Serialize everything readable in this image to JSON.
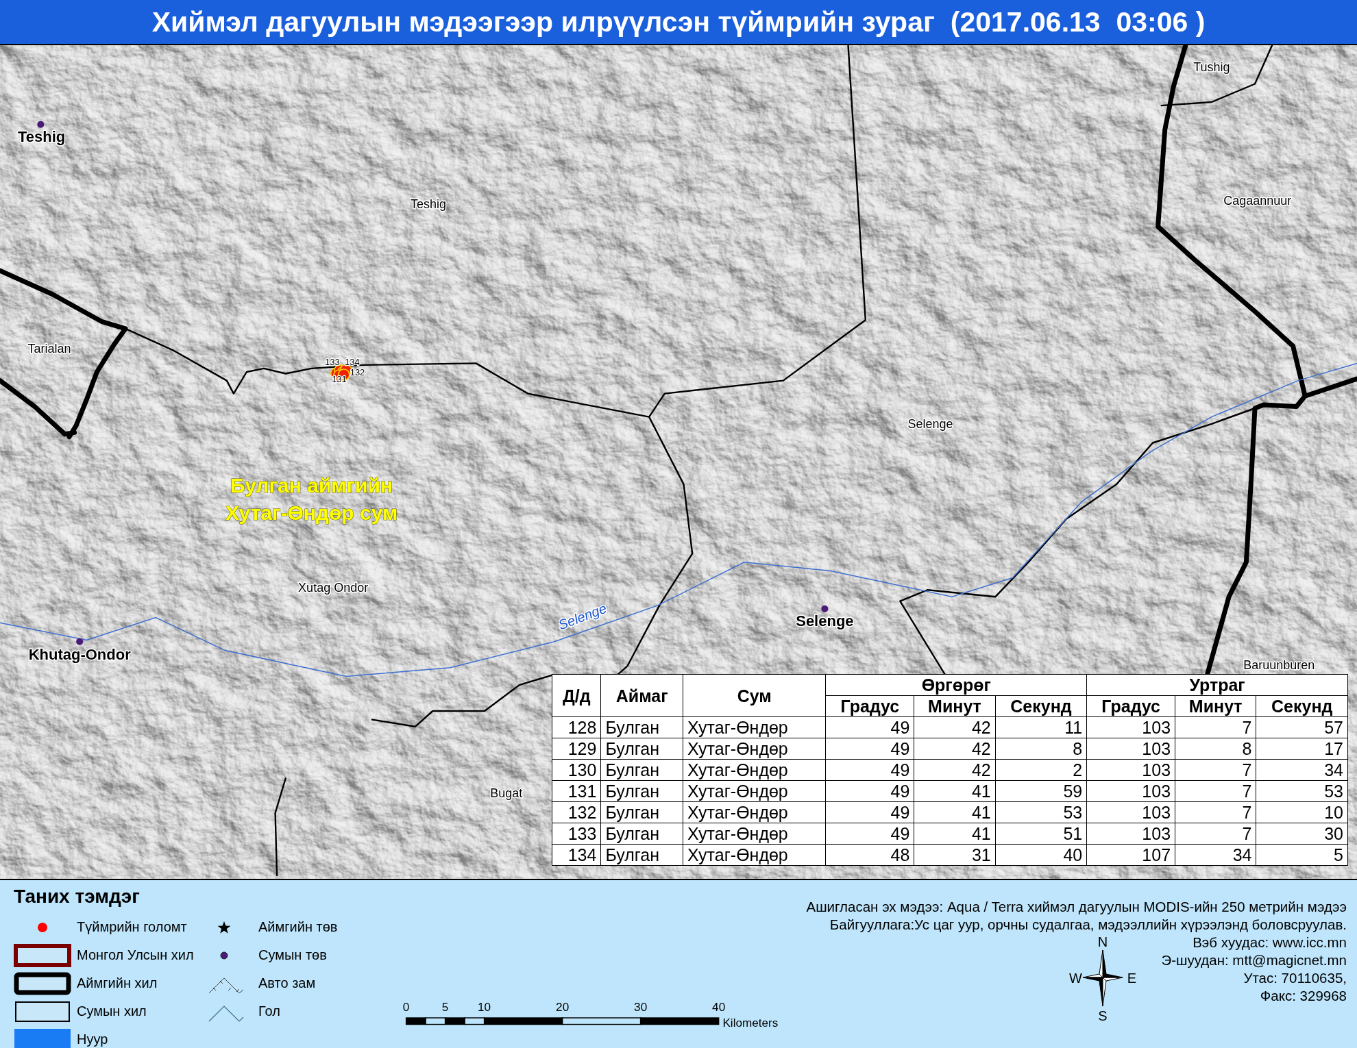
{
  "title": "Хиймэл дагуулын мэдээгээр илрүүлсэн түймрийн зураг  (2017.06.13  03:06 )",
  "map": {
    "labels": [
      {
        "text": "Teshig",
        "kind": "sum-center"
      },
      {
        "text": "Teshig",
        "kind": "sum-name"
      },
      {
        "text": "Tushig",
        "kind": "sum-name"
      },
      {
        "text": "Cagaannuur",
        "kind": "sum-name"
      },
      {
        "text": "Tarialan",
        "kind": "sum-name"
      },
      {
        "text": "Selenge",
        "kind": "sum-name"
      },
      {
        "text": "Булган аймгийн",
        "kind": "region"
      },
      {
        "text": "Хутаг-Өндөр сум",
        "kind": "region"
      },
      {
        "text": "Xutag Ondor",
        "kind": "sum-name"
      },
      {
        "text": "Selenge",
        "kind": "river"
      },
      {
        "text": "Selenge",
        "kind": "sum-center"
      },
      {
        "text": "Khutag-Ondor",
        "kind": "sum-center"
      },
      {
        "text": "Bugat",
        "kind": "sum-name"
      },
      {
        "text": "Baruunburen",
        "kind": "sum-name"
      }
    ],
    "fire_labels": [
      "133",
      "134",
      "132",
      "131"
    ]
  },
  "table": {
    "columns": [
      "Д/д",
      "Аймаг",
      "Сум"
    ],
    "groups": [
      {
        "name": "Өргөрөг",
        "columns": [
          "Градус",
          "Минут",
          "Секунд"
        ]
      },
      {
        "name": "Уртраг",
        "columns": [
          "Градус",
          "Минут",
          "Секунд"
        ]
      }
    ],
    "rows": [
      [
        "128",
        "Булган",
        "Хутаг-Өндөр",
        "49",
        "42",
        "11",
        "103",
        "7",
        "57"
      ],
      [
        "129",
        "Булган",
        "Хутаг-Өндөр",
        "49",
        "42",
        "8",
        "103",
        "8",
        "17"
      ],
      [
        "130",
        "Булган",
        "Хутаг-Өндөр",
        "49",
        "42",
        "2",
        "103",
        "7",
        "34"
      ],
      [
        "131",
        "Булган",
        "Хутаг-Өндөр",
        "49",
        "41",
        "59",
        "103",
        "7",
        "53"
      ],
      [
        "132",
        "Булган",
        "Хутаг-Өндөр",
        "49",
        "41",
        "53",
        "103",
        "7",
        "10"
      ],
      [
        "133",
        "Булган",
        "Хутаг-Өндөр",
        "49",
        "41",
        "51",
        "103",
        "7",
        "30"
      ],
      [
        "134",
        "Булган",
        "Хутаг-Өндөр",
        "48",
        "31",
        "40",
        "107",
        "34",
        "5"
      ]
    ]
  },
  "legend": {
    "title": "Таних тэмдэг",
    "items": [
      {
        "kind": "fire",
        "label": "Түймрийн голомт"
      },
      {
        "kind": "country-border",
        "label": "Монгол Улсын хил"
      },
      {
        "kind": "aimag-border",
        "label": "Аймгийн хил"
      },
      {
        "kind": "sum-border",
        "label": "Сумын хил"
      },
      {
        "kind": "lake",
        "label": "Нуур"
      },
      {
        "kind": "aimag-center",
        "label": "Аймгийн төв"
      },
      {
        "kind": "sum-center",
        "label": "Сумын төв"
      },
      {
        "kind": "road",
        "label": "Авто зам"
      },
      {
        "kind": "river",
        "label": "Гол"
      }
    ]
  },
  "scale_bar": {
    "ticks": [
      "0",
      "5",
      "10",
      "20",
      "30",
      "40"
    ],
    "unit": "Kilometers"
  },
  "credits": [
    "Ашигласан эх мэдээ: Aqua / Terra хиймэл дагуулын MODIS-ийн 250 метрийн мэдээ",
    "Байгууллага:Ус цаг уур, орчны судалгаа, мэдээллийн хүрээлэнд боловсруулав.",
    "Вэб хуудас: www.icc.mn",
    "Э-шуудан: mtt@magicnet.mn",
    "Утас: 70110635,",
    "Факс: 329968"
  ],
  "compass": {
    "n": "N",
    "w": "W",
    "e": "E",
    "s": "S"
  }
}
